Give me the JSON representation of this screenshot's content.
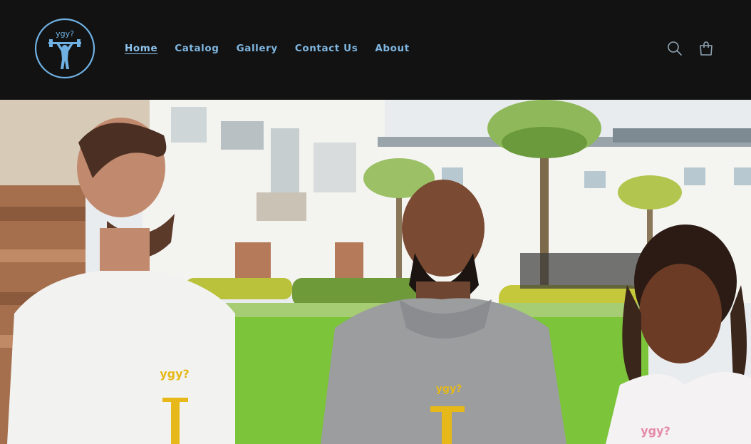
{
  "brand": {
    "logo_text": "ygy?",
    "logo_color": "#6fb1e3",
    "icon": "weightlifter-icon"
  },
  "nav": {
    "items": [
      {
        "label": "Home",
        "active": true
      },
      {
        "label": "Catalog",
        "active": false
      },
      {
        "label": "Gallery",
        "active": false
      },
      {
        "label": "Contact Us",
        "active": false
      },
      {
        "label": "About",
        "active": false
      }
    ]
  },
  "header_icons": {
    "search": "search-icon",
    "cart": "cart-icon",
    "color": "#8fa3b3"
  },
  "hero": {
    "shirt_text_left": "ygy?",
    "shirt_text_center": "ygy?",
    "shirt_text_right": "ygy?",
    "accent_yellow": "#e6b819",
    "accent_pink": "#e58aa8"
  }
}
